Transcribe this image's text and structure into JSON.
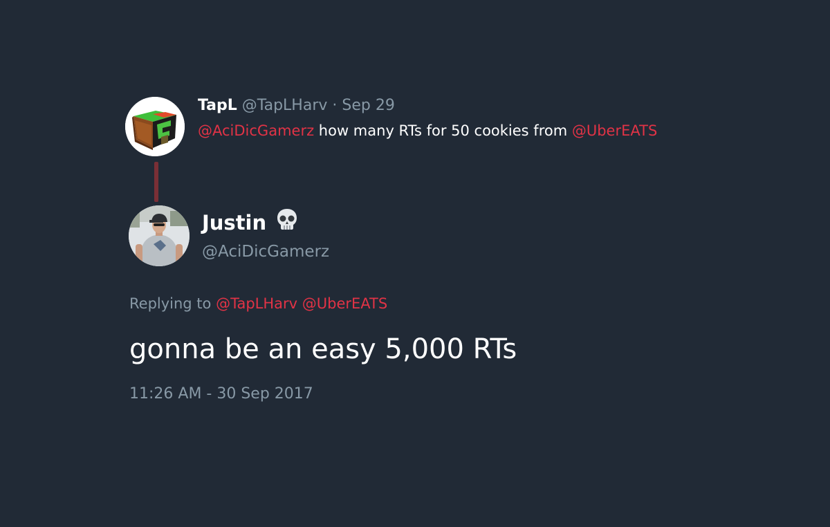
{
  "colors": {
    "background": "#212a36",
    "text": "#ffffff",
    "muted": "#8899a6",
    "mention": "#e13346",
    "thread_line": "#7a2f36"
  },
  "parent_tweet": {
    "avatar_icon": "green-orange-cube-logo",
    "name": "TapL",
    "handle": "@TapLHarv",
    "separator": "·",
    "date": "Sep 29",
    "mention_1": "@AciDicGamerz",
    "text_middle": "how many RTs for 50 cookies from",
    "mention_2": "@UberEATS"
  },
  "main_tweet": {
    "avatar_icon": "person-in-cap-photo",
    "name": "Justin",
    "name_emoji_icon": "skull-emoji",
    "handle": "@AciDicGamerz",
    "replying_prefix": "Replying to",
    "replying_mention_1": "@TapLHarv",
    "replying_mention_2": "@UberEATS",
    "text": "gonna be an easy 5,000 RTs",
    "timestamp": "11:26 AM - 30 Sep 2017"
  }
}
